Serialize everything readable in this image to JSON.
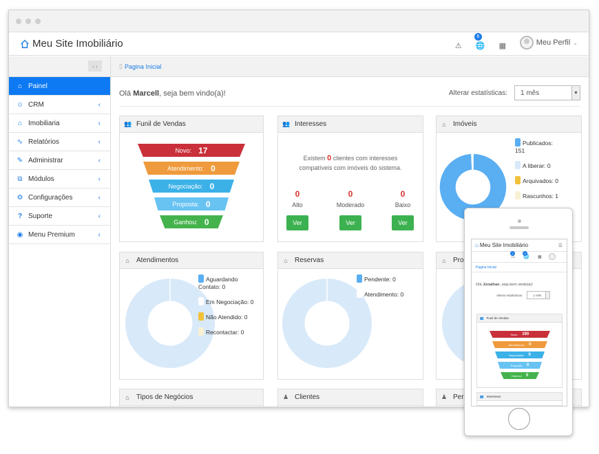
{
  "app": {
    "title": "Meu Site Imobiliário"
  },
  "header": {
    "alerts_badge": "",
    "globe_badge": "6",
    "profile_label": "Meu Perfil"
  },
  "sidebar": {
    "items": [
      {
        "label": "Painel",
        "icon": "home-icon"
      },
      {
        "label": "CRM",
        "icon": "users-icon"
      },
      {
        "label": "Imobiliaria",
        "icon": "home-icon"
      },
      {
        "label": "Relatórios",
        "icon": "pulse-icon"
      },
      {
        "label": "Administrar",
        "icon": "wrench-icon"
      },
      {
        "label": "Módulos",
        "icon": "puzzle-icon"
      },
      {
        "label": "Configurações",
        "icon": "gear-icon"
      },
      {
        "label": "Suporte",
        "icon": "question-icon"
      },
      {
        "label": "Menu Premium",
        "icon": "eye-icon"
      }
    ]
  },
  "breadcrumb": {
    "label": "Pagina Inicial"
  },
  "greeting": {
    "prefix": "Olá ",
    "name": "Marcell",
    "suffix": ", seja bem vindo(a)!"
  },
  "stats": {
    "label": "Alterar estatísticas:",
    "value": "1 mês"
  },
  "panels": {
    "funnel": {
      "title": "Funil de Vendas",
      "rows": [
        {
          "label": "Novo:",
          "value": "17",
          "color": "#c9303a"
        },
        {
          "label": "Atendimento:",
          "value": "0",
          "color": "#ef9a3c"
        },
        {
          "label": "Negociação:",
          "value": "0",
          "color": "#3bb1e8"
        },
        {
          "label": "Proposta:",
          "value": "0",
          "color": "#68c3f3"
        },
        {
          "label": "Ganhou:",
          "value": "0",
          "color": "#45b34c"
        }
      ]
    },
    "interesses": {
      "title": "Interesses",
      "text_a": "Existem ",
      "count": "0",
      "text_b": " clientes com interesses",
      "text_c": "compatíveis com imóveis do sistema.",
      "levels": [
        {
          "value": "0",
          "label": "Alto",
          "button": "Ver"
        },
        {
          "value": "0",
          "label": "Moderado",
          "button": "Ver"
        },
        {
          "value": "0",
          "label": "Baixo",
          "button": "Ver"
        }
      ]
    },
    "imoveis": {
      "title": "Imóveis",
      "legend": [
        {
          "label": "Publicados:",
          "value": "151",
          "color": "#5aaef2"
        },
        {
          "label": "A liberar:",
          "value": "0",
          "color": "#d8e9f9"
        },
        {
          "label": "Arquivados:",
          "value": "0",
          "color": "#f2c13c"
        },
        {
          "label": "Rascunhos:",
          "value": "1",
          "color": "#f9f1d4"
        }
      ]
    },
    "atendimentos": {
      "title": "Atendimentos",
      "legend": [
        {
          "label": "Aguardando Contato:",
          "value": "0",
          "color": "#5aaef2"
        },
        {
          "label": "Em Negociação:",
          "value": "0",
          "color": "#ffffff"
        },
        {
          "label": "Não Atendido:",
          "value": "0",
          "color": "#f2c13c"
        },
        {
          "label": "Recontactar:",
          "value": "0",
          "color": "#f9f1d4"
        }
      ]
    },
    "reservas": {
      "title": "Reservas",
      "legend": [
        {
          "label": "Pendente:",
          "value": "0",
          "color": "#5aaef2"
        },
        {
          "label": "Atendimento:",
          "value": "0",
          "color": "#ffffff"
        }
      ]
    },
    "propostas": {
      "title": "Pro"
    },
    "tipos": {
      "title": "Tipos de Negócios"
    },
    "clientes": {
      "title": "Clientes"
    },
    "perfil": {
      "title": "Per"
    }
  },
  "chart_data": [
    {
      "type": "pie",
      "title": "Imóveis",
      "categories": [
        "Publicados",
        "A liberar",
        "Arquivados",
        "Rascunhos"
      ],
      "values": [
        151,
        0,
        0,
        1
      ]
    },
    {
      "type": "pie",
      "title": "Atendimentos",
      "categories": [
        "Aguardando Contato",
        "Em Negociação",
        "Não Atendido",
        "Recontactar"
      ],
      "values": [
        0,
        0,
        0,
        0
      ]
    },
    {
      "type": "pie",
      "title": "Reservas",
      "categories": [
        "Pendente",
        "Atendimento"
      ],
      "values": [
        0,
        0
      ]
    }
  ],
  "phone": {
    "title": "Meu Site Imobiliário",
    "badge_a": "2",
    "badge_b": "4",
    "breadcrumb": "Pagina Inicial",
    "greeting_prefix": "Olá ",
    "greeting_name": "Jonathan",
    "greeting_suffix": ", seja bem vindo(a)!",
    "stats_label": "Alterar estatísticas:",
    "stats_value": "1 mês",
    "funnel_title": "Funil de Vendas",
    "funnel": [
      {
        "label": "Novo:",
        "value": "190"
      },
      {
        "label": "Atendimento:",
        "value": "0"
      },
      {
        "label": "Negociação:",
        "value": "0"
      },
      {
        "label": "Proposta:",
        "value": "0"
      },
      {
        "label": "Ganhou:",
        "value": "0"
      }
    ],
    "interesses_title": "Interesses"
  }
}
